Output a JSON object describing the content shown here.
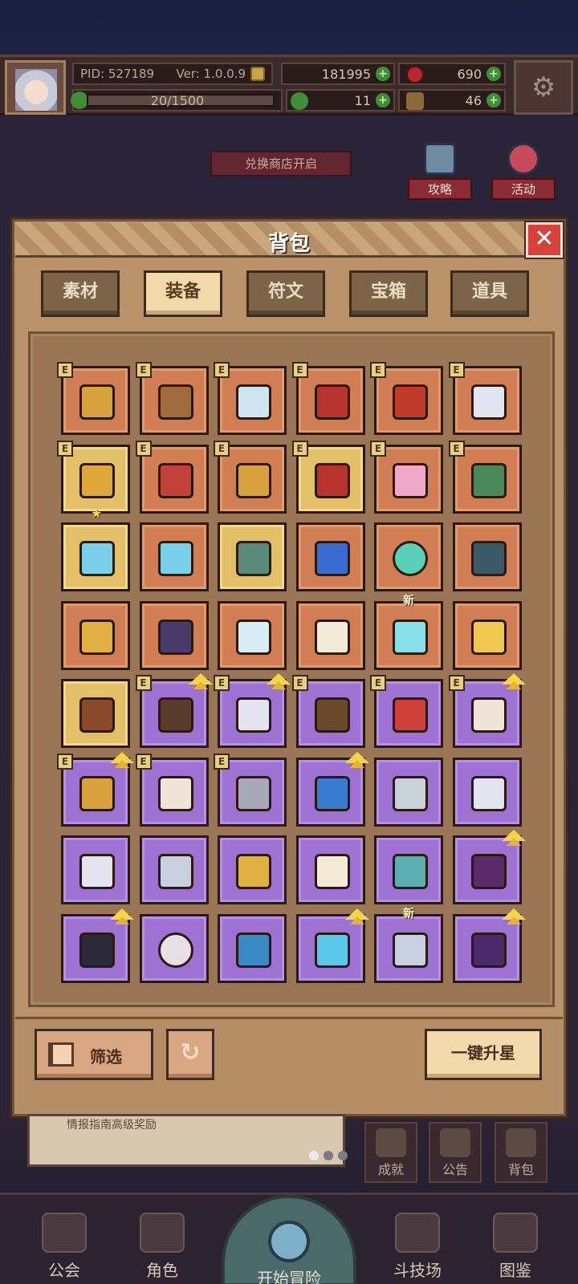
{
  "hud": {
    "pid_label": "PID: 527189",
    "version": "Ver: 1.0.0.9",
    "gold": "181995",
    "gems": "690",
    "exp": "20/1500",
    "clover": "11",
    "bag_count": "46",
    "add_symbol": "+"
  },
  "scene": {
    "shop_banner": "兑换商店开启",
    "guide_label": "攻略",
    "event_label": "活动",
    "notice_text": "情报指南高级奖励"
  },
  "panel": {
    "title": "背包",
    "close_symbol": "✕",
    "tabs": [
      {
        "label": "素材",
        "active": false
      },
      {
        "label": "装备",
        "active": true
      },
      {
        "label": "符文",
        "active": false
      },
      {
        "label": "宝箱",
        "active": false
      },
      {
        "label": "道具",
        "active": false
      }
    ],
    "badge_letter": "E",
    "new_label": "新",
    "star_symbol": "★",
    "filter_label": "筛选",
    "refresh_symbol": "↻",
    "upgrade_label": "一键升星"
  },
  "items": [
    [
      {
        "rarity": "orange",
        "icon": "golden-scepter-icon",
        "color": "#d8a13c",
        "e": true
      },
      {
        "rarity": "orange",
        "icon": "bronze-helmet-icon",
        "color": "#a06a3a",
        "e": true
      },
      {
        "rarity": "orange",
        "icon": "silver-armor-icon",
        "color": "#cfe6f2",
        "e": true
      },
      {
        "rarity": "orange",
        "icon": "red-gold-armor-icon",
        "color": "#b8322e",
        "e": true
      },
      {
        "rarity": "orange",
        "icon": "red-gauntlet-icon",
        "color": "#c23a2c",
        "e": true
      },
      {
        "rarity": "orange",
        "icon": "white-gauntlet-icon",
        "color": "#e4e4f0",
        "e": true
      }
    ],
    [
      {
        "rarity": "gold",
        "icon": "gold-necklace-icon",
        "color": "#e0a83a",
        "e": true,
        "star": true
      },
      {
        "rarity": "orange",
        "icon": "ruby-crown-icon",
        "color": "#c2423a",
        "e": true
      },
      {
        "rarity": "orange",
        "icon": "gold-boots-icon",
        "color": "#d8a13c",
        "e": true
      },
      {
        "rarity": "gold",
        "icon": "red-boots-icon",
        "color": "#b8322e",
        "e": true
      },
      {
        "rarity": "orange",
        "icon": "heart-amulet-icon",
        "color": "#f0a8c8",
        "e": true
      },
      {
        "rarity": "orange",
        "icon": "emerald-necklace-icon",
        "color": "#4a8a5a",
        "e": true
      }
    ],
    [
      {
        "rarity": "gold",
        "icon": "ice-staff-icon",
        "color": "#7ad0e8",
        "e": false
      },
      {
        "rarity": "orange",
        "icon": "ice-wand-icon",
        "color": "#7ad0e8",
        "e": false
      },
      {
        "rarity": "gold",
        "icon": "jade-staff-icon",
        "color": "#5a8a7a",
        "e": false
      },
      {
        "rarity": "orange",
        "icon": "sapphire-staff-icon",
        "color": "#3a6ad0",
        "e": false
      },
      {
        "rarity": "orange",
        "icon": "teal-orb-icon",
        "color": "#5ad0b8",
        "e": false
      },
      {
        "rarity": "orange",
        "icon": "horned-helmet-icon",
        "color": "#3a5a6a",
        "e": false
      }
    ],
    [
      {
        "rarity": "orange",
        "icon": "gold-shield-icon",
        "color": "#e0b040",
        "e": false
      },
      {
        "rarity": "orange",
        "icon": "dark-crown-icon",
        "color": "#4a3a6a",
        "e": false
      },
      {
        "rarity": "orange",
        "icon": "crystal-shell-icon",
        "color": "#d8ecf4",
        "e": false
      },
      {
        "rarity": "orange",
        "icon": "white-star-emblem-icon",
        "color": "#f4ead8",
        "e": false
      },
      {
        "rarity": "orange",
        "icon": "aqua-crystal-icon",
        "color": "#8ae0e8",
        "e": false,
        "new": true
      },
      {
        "rarity": "orange",
        "icon": "gold-star-emblem-icon",
        "color": "#f0c850",
        "e": false
      }
    ],
    [
      {
        "rarity": "gold",
        "icon": "bronze-amulet-icon",
        "color": "#8a4a2a",
        "e": false
      },
      {
        "rarity": "purple",
        "icon": "bow-icon",
        "color": "#5a3a2a",
        "e": true,
        "up": true
      },
      {
        "rarity": "purple",
        "icon": "white-greatsword-icon",
        "color": "#e4e4f0",
        "e": true,
        "up": true
      },
      {
        "rarity": "purple",
        "icon": "wooden-armor-icon",
        "color": "#6a4a2a",
        "e": true
      },
      {
        "rarity": "purple",
        "icon": "red-slime-helmet-icon",
        "color": "#d0403a",
        "e": true
      },
      {
        "rarity": "purple",
        "icon": "bone-gauntlet-icon",
        "color": "#f0e4d8",
        "e": true,
        "up": true
      }
    ],
    [
      {
        "rarity": "purple",
        "icon": "gold-belt-icon",
        "color": "#d8a13c",
        "e": true,
        "up": true
      },
      {
        "rarity": "purple",
        "icon": "cloth-boots-icon",
        "color": "#f0e4d8",
        "e": true
      },
      {
        "rarity": "purple",
        "icon": "gem-ring-icon",
        "color": "#a8a8b8",
        "e": true
      },
      {
        "rarity": "purple",
        "icon": "blue-scepter-icon",
        "color": "#3a7ad0",
        "e": false,
        "up": true
      },
      {
        "rarity": "purple",
        "icon": "cleaver-icon",
        "color": "#c8d0d8",
        "e": false
      },
      {
        "rarity": "purple",
        "icon": "scimitar-icon",
        "color": "#e4e4f0",
        "e": false
      }
    ],
    [
      {
        "rarity": "purple",
        "icon": "dagger-icon",
        "color": "#e4e4f0",
        "e": false
      },
      {
        "rarity": "purple",
        "icon": "short-sword-icon",
        "color": "#c8d0e0",
        "e": false
      },
      {
        "rarity": "purple",
        "icon": "golden-rod-icon",
        "color": "#e0b040",
        "e": false
      },
      {
        "rarity": "purple",
        "icon": "star-wand-icon",
        "color": "#f4ead8",
        "e": false
      },
      {
        "rarity": "purple",
        "icon": "jade-dagger-icon",
        "color": "#5ab0b0",
        "e": false
      },
      {
        "rarity": "purple",
        "icon": "dark-orb-icon",
        "color": "#5a2a6a",
        "e": false,
        "up": true
      }
    ],
    [
      {
        "rarity": "purple",
        "icon": "black-dagger-icon",
        "color": "#2a2a3a",
        "e": false,
        "up": true
      },
      {
        "rarity": "purple",
        "icon": "pearl-orb-icon",
        "color": "#e8e0e4",
        "e": false
      },
      {
        "rarity": "purple",
        "icon": "spellbook-icon",
        "color": "#3a8ac8",
        "e": false
      },
      {
        "rarity": "purple",
        "icon": "ice-spear-icon",
        "color": "#5ac8e8",
        "e": false,
        "up": true
      },
      {
        "rarity": "purple",
        "icon": "silver-spear-icon",
        "color": "#c8d0e0",
        "e": false,
        "new": true
      },
      {
        "rarity": "purple",
        "icon": "wizard-hat-icon",
        "color": "#4a2a6a",
        "e": false,
        "up": true
      }
    ]
  ],
  "under": {
    "achievement_label": "成就",
    "announcement_label": "公告",
    "backpack_label": "背包"
  },
  "nav": {
    "guild": "公会",
    "character": "角色",
    "adventure": "开始冒险",
    "arena": "斗技场",
    "codex": "图鉴"
  }
}
